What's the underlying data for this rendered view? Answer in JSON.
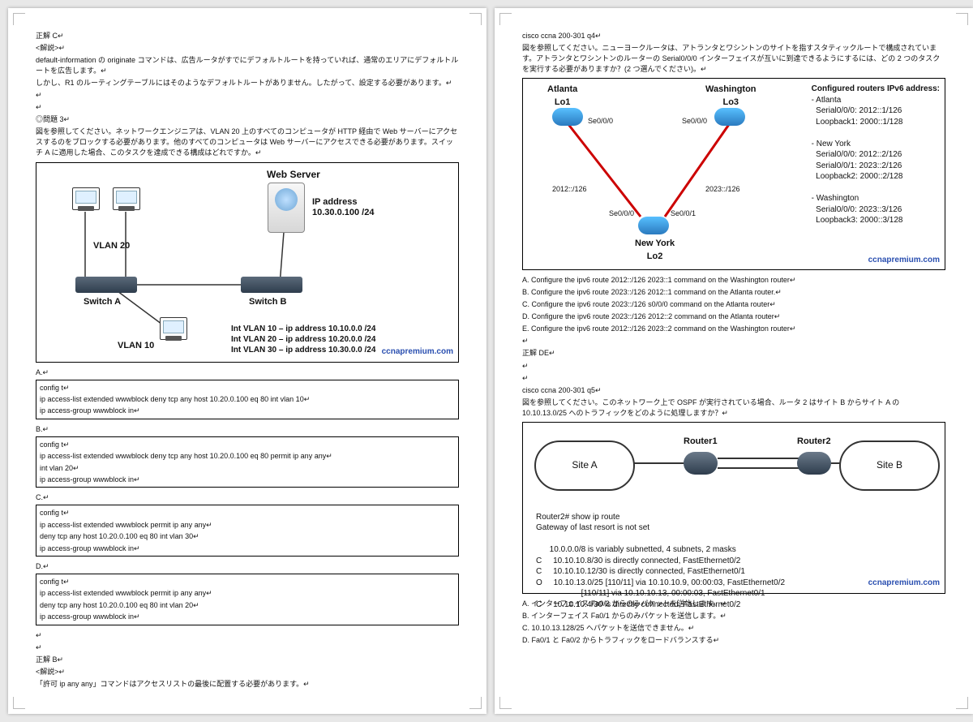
{
  "left": {
    "ans1": "正解 C↵",
    "expl_hdr": "<解説>↵",
    "expl1": "default-information の originate コマンドは、広告ルータがすでにデフォルトルートを持っていれば、通常のエリアにデフォルトルートを広告します。↵",
    "expl2": "しかし、R1 のルーティングテーブルにはそのようなデフォルトルートがありません。したがって、設定する必要があります。↵",
    "sep": "↵",
    "q3_hdr": "◎問題 3↵",
    "q3_1": "図を参照してください。ネットワークエンジニアは、VLAN 20 上のすべてのコンピュータが HTTP 経由で Web サーバーにアクセスするのをブロックする必要があります。他のすべてのコンピュータは Web サーバーにアクセスできる必要があります。スイッチ A に適用した場合、このタスクを達成できる構成はどれですか。↵",
    "d1": {
      "ws": "Web Server",
      "ip1": "IP address",
      "ip2": "10.30.0.100 /24",
      "vlan20": "VLAN 20",
      "vlan10": "VLAN 10",
      "swa": "Switch A",
      "swb": "Switch B",
      "int1": "Int VLAN 10 – ip address 10.10.0.0 /24",
      "int2": "Int VLAN 20 – ip address 10.20.0.0 /24",
      "int3": "Int VLAN 30 – ip address 10.30.0.0 /24",
      "wm": "ccnapremium.com"
    },
    "optA": "A.↵",
    "boxA": [
      "config t↵",
      "ip access-list extended wwwblock deny tcp any host 10.20.0.100 eq 80 int vlan 10↵",
      "ip access-group wwwblock in↵"
    ],
    "optB": "B.↵",
    "boxB": [
      "config t↵",
      "ip access-list extended wwwblock deny tcp any host 10.20.0.100 eq 80 permit ip any any↵",
      "int vlan 20↵",
      "ip access-group wwwblock in↵"
    ],
    "optC": "C.↵",
    "boxC": [
      "config t↵",
      "ip access-list extended wwwblock permit ip any any↵",
      "deny tcp any host 10.20.0.100 eq 80 int vlan 30↵",
      "ip access-group wwwblock in↵"
    ],
    "optD": "D.↵",
    "boxD": [
      "config t↵",
      "ip access-list extended wwwblock permit ip any any↵",
      "deny tcp any host 10.20.0.100 eq 80 int vlan 20↵",
      "ip access-group wwwblock in↵"
    ],
    "ans3": "正解 B↵",
    "expl3a": "<解説>↵",
    "expl3b": "「許可 ip any any」コマンドはアクセスリストの最後に配置する必要があります。↵"
  },
  "right": {
    "q4_hdr": "cisco ccna 200-301 q4↵",
    "q4_1": "図を参照してください。ニューヨークルータは、アトランタとワシントンのサイトを指すスタティックルートで構成されています。アトランタとワシントンのルーターの Serial0/0/0 インターフェイスが互いに到達できるようにするには、どの 2 つのタスクを実行する必要がありますか？(2 つ選んでください)。↵",
    "d2": {
      "atl": "Atlanta",
      "atl2": "Lo1",
      "was": "Washington",
      "was2": "Lo3",
      "ny": "New York",
      "ny2": "Lo2",
      "se000": "Se0/0/0",
      "se001": "Se0/0/1",
      "n2012": "2012::/126",
      "n2023": "2023::/126",
      "cfg_title": "Configured routers IPv6 address:",
      "cfg": [
        "- Atlanta",
        "  Serial0/0/0: 2012::1/126",
        "  Loopback1: 2000::1/128",
        "",
        "- New York",
        "  Serial0/0/0: 2012::2/126",
        "  Serial0/0/1: 2023::2/126",
        "  Loopback2: 2000::2/128",
        "",
        "- Washington",
        "  Serial0/0/0: 2023::3/126",
        "  Loopback3: 2000::3/128"
      ],
      "wm": "ccnapremium.com"
    },
    "q4_opts": [
      "A. Configure the ipv6 route 2012::/126 2023::1 command on the Washington router↵",
      "B. Configure the ipv6 route 2023::/126 2012::1 command on the Atlanta router.↵",
      "C. Configure the ipv6 route 2023::/126 s0/0/0 command on the Atlanta router↵",
      "D. Configure the ipv6 route 2023::/126 2012::2 command on the Atlanta router↵",
      "E. Configure the ipv6 route 2012::/126 2023::2 command on the Washington router↵"
    ],
    "ans4": "正解 DE↵",
    "q5_hdr": "cisco ccna 200-301 q5↵",
    "q5_1": "図を参照してください。このネットワーク上で OSPF が実行されている場合、ルータ 2 はサイト B からサイト A の 10.10.13.0/25 へのトラフィックをどのように処理しますか？↵",
    "d3": {
      "siteA": "Site A",
      "siteB": "Site B",
      "r1": "Router1",
      "r2": "Router2",
      "term": [
        "Router2# show ip route",
        "Gateway of last resort is not set",
        "",
        "      10.0.0.0/8 is variably subnetted, 4 subnets, 2 masks",
        "C     10.10.10.8/30 is directly connected, FastEthernet0/2",
        "C     10.10.10.12/30 is directly connected, FastEthernet0/1",
        "O     10.10.13.0/25 [110/11] via 10.10.10.9, 00:00:03, FastEthernet0/2",
        "                    [110/11] via 10.10.10.13, 00:00:03, FastEthernet0/1",
        "C     10.10.10.4/30 is directly connected, FastEthernet0/2"
      ],
      "wm": "ccnapremium.com"
    },
    "q5_opts": [
      "A. インターフェイス Fa0/2 からのみパケットを送信します。↵",
      "B. インターフェイス Fa0/1 からのみパケットを送信します。↵",
      "C. 10.10.13.128/25 へパケットを送信できません。↵",
      "D. Fa0/1 と Fa0/2 からトラフィックをロードバランスする↵"
    ]
  }
}
